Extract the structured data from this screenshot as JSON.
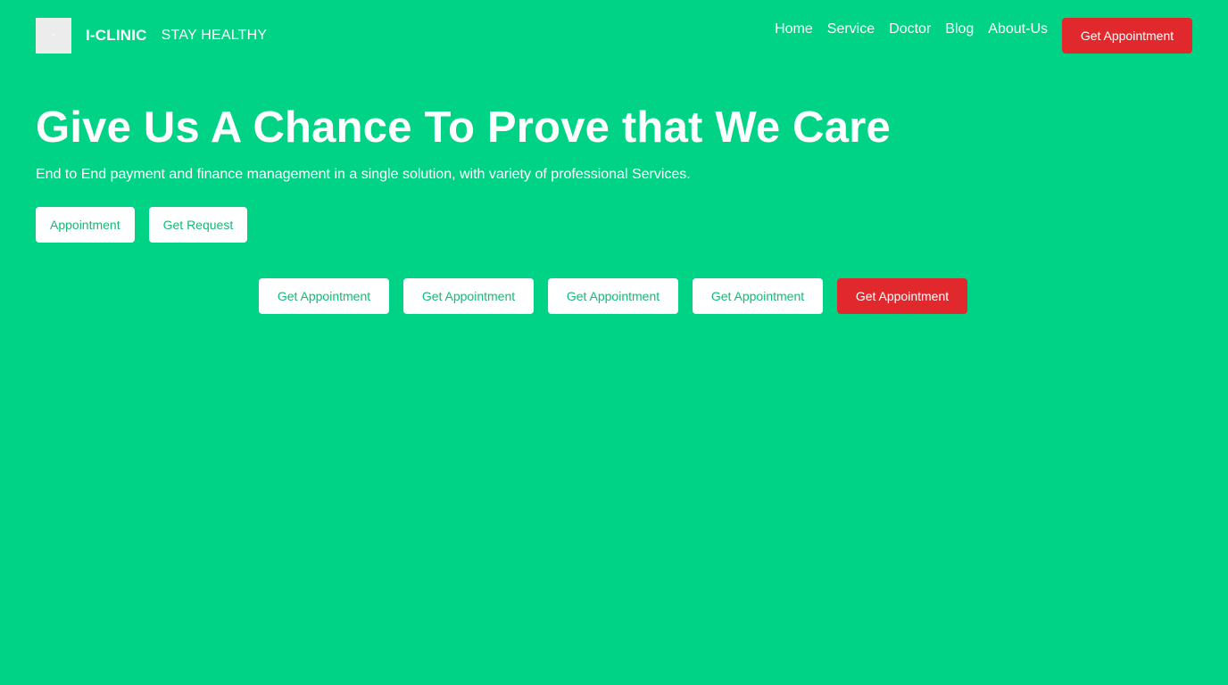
{
  "header": {
    "brand_name": "I-CLINIC",
    "tagline": "STAY HEALTHY",
    "logo_icon": "image-placeholder-icon",
    "nav": [
      {
        "label": "Home"
      },
      {
        "label": "Service"
      },
      {
        "label": "Doctor"
      },
      {
        "label": "Blog"
      },
      {
        "label": "About-Us"
      }
    ],
    "cta_label": "Get Appointment"
  },
  "hero": {
    "title": "Give Us A Chance To Prove that We Care",
    "subtitle": "End to End payment and finance management in a single solution, with variety of professional Services.",
    "buttons": [
      {
        "label": "Appointment"
      },
      {
        "label": "Get Request"
      }
    ]
  },
  "appointment_buttons": [
    {
      "label": "Get Appointment",
      "variant": "white"
    },
    {
      "label": "Get Appointment",
      "variant": "white"
    },
    {
      "label": "Get Appointment",
      "variant": "white"
    },
    {
      "label": "Get Appointment",
      "variant": "white"
    },
    {
      "label": "Get Appointment",
      "variant": "red"
    }
  ],
  "colors": {
    "background": "#00d385",
    "accent_red": "#e1282c",
    "button_text_green": "#16b976",
    "text_white": "#ffffff"
  }
}
